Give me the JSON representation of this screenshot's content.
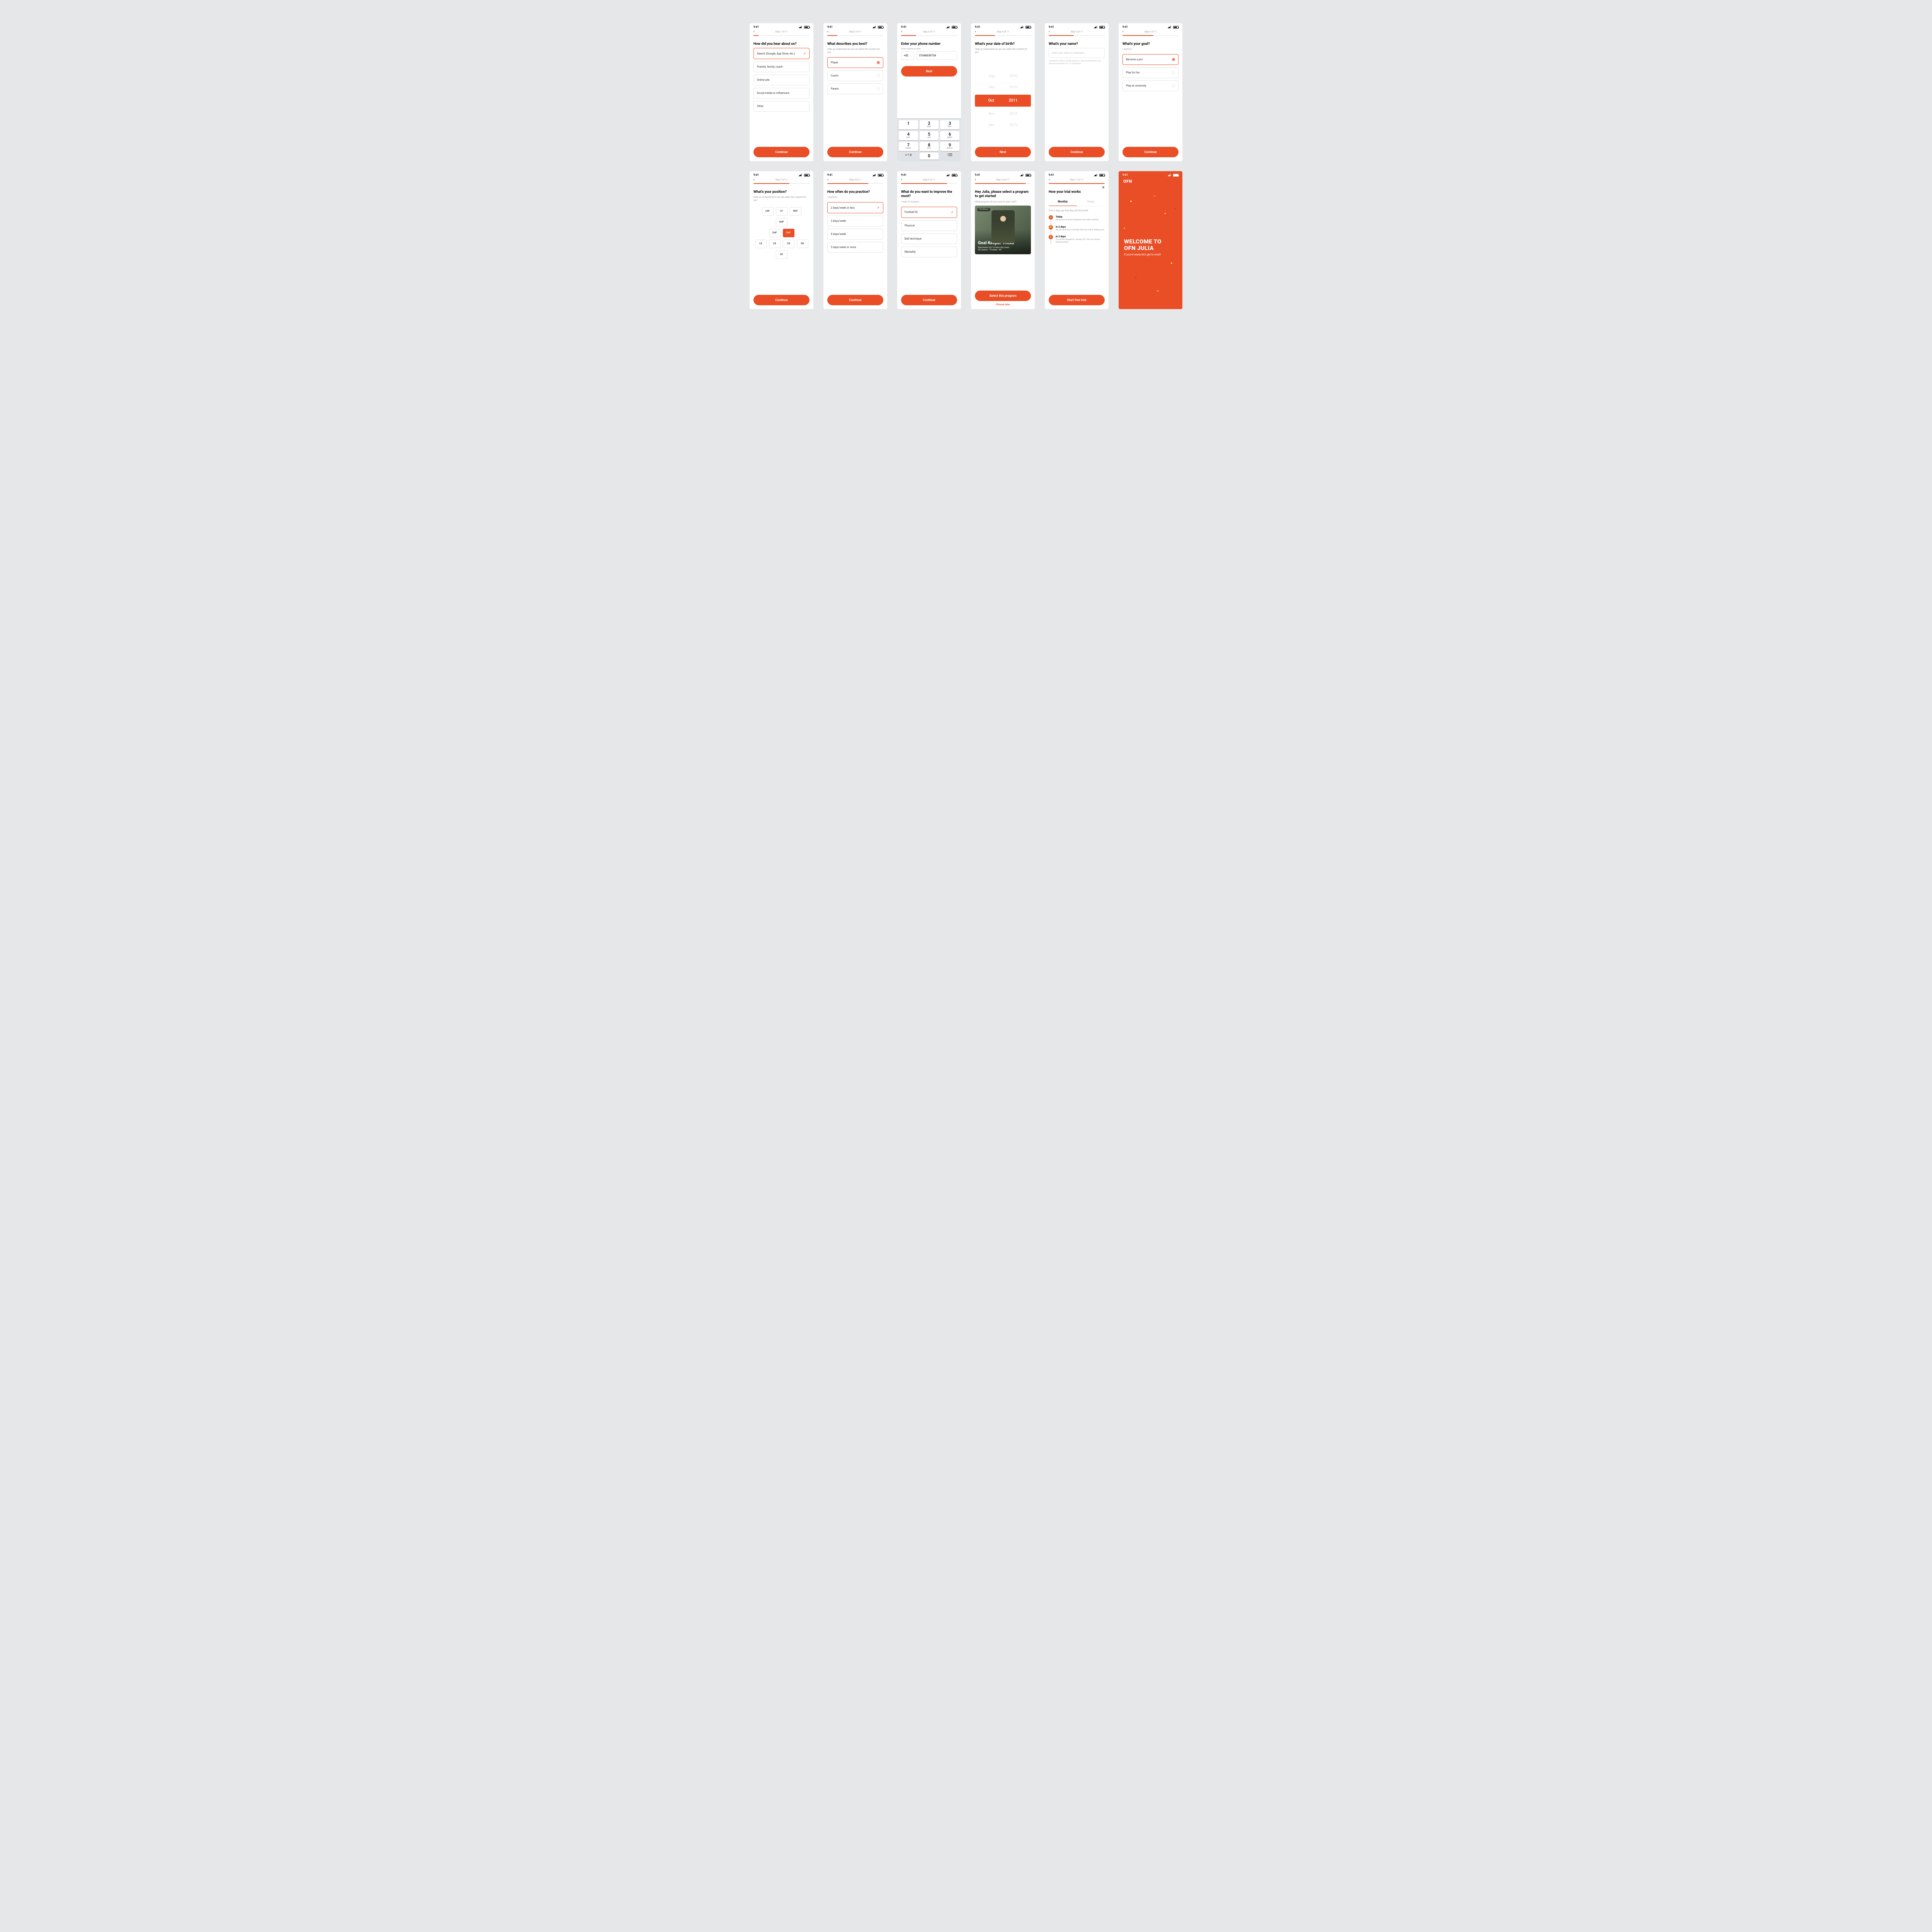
{
  "status": {
    "time": "9:41"
  },
  "colors": {
    "accent": "#E94E26"
  },
  "screens": [
    {
      "step": "Step 1 of 11",
      "progress": 0.09,
      "title": "How did you hear about us?",
      "options": [
        "Search  (Google, App Store, etc.)",
        "Friends, family, coach",
        "Online ads",
        "Social media or influencers",
        "Other"
      ],
      "selected_index": 0,
      "cta": "Continue"
    },
    {
      "step": "Step 2 of 11",
      "progress": 0.18,
      "title": "What describes you best?",
      "subtitle": "Help us understand so we can tailor the content for you",
      "options": [
        "Player",
        "Coach",
        "Parent"
      ],
      "selected_index": 0,
      "cta": "Continue"
    },
    {
      "step": "Step 3 of 11",
      "progress": 0.27,
      "title": "Enter your phone number",
      "field_label": "Enter mobile number",
      "country_code": "+82",
      "phone_value": "01046039734",
      "cta": "Next",
      "keypad": [
        {
          "n": "1",
          "l": ""
        },
        {
          "n": "2",
          "l": "ABC"
        },
        {
          "n": "3",
          "l": "DEF"
        },
        {
          "n": "4",
          "l": "GHI"
        },
        {
          "n": "5",
          "l": "JKL"
        },
        {
          "n": "6",
          "l": "MNO"
        },
        {
          "n": "7",
          "l": "PQRS"
        },
        {
          "n": "8",
          "l": "TUV"
        },
        {
          "n": "9",
          "l": "WXYZ"
        },
        {
          "n": "+ * #",
          "l": ""
        },
        {
          "n": "0",
          "l": ""
        },
        {
          "n": "⌫",
          "l": ""
        }
      ]
    },
    {
      "step": "Step 4 of 11",
      "progress": 0.36,
      "title": "What's your date of birth?",
      "subtitle": "Help us understand so we can tailor the content for you",
      "months": [
        "Aug",
        "Sep",
        "Oct",
        "Nov",
        "Dec"
      ],
      "years": [
        "2010",
        "2010",
        "2011",
        "2012",
        "2013"
      ],
      "selected_row": 2,
      "cta": "Next"
    },
    {
      "step": "Step 5 of 11",
      "progress": 0.45,
      "title": "What's your name?",
      "placeholder": "Enter your name or nickname",
      "helper": "Usernames cannot contain spaces or special characters, and should be between 6 to 15 characters.",
      "cta": "Continue"
    },
    {
      "step": "Step 6 of 11",
      "progress": 0.55,
      "title": "What's your goal?",
      "subtitle": "I want to…",
      "options": [
        "Become a pro",
        "Play for fun",
        "Play at university"
      ],
      "selected_index": 0,
      "cta": "Continue"
    },
    {
      "step": "Step 7 of 11",
      "progress": 0.64,
      "title": "What's your position?",
      "subtitle": "Help us understand so we can tailor the content for you",
      "positions": [
        [
          "LWF",
          "CF",
          "RWF"
        ],
        [
          "AMF"
        ],
        [
          "CMF",
          "DMF"
        ],
        [
          "LB",
          "CB",
          "CB",
          "RB"
        ],
        [
          "GK"
        ]
      ],
      "selected": "DMF",
      "cta": "Continue"
    },
    {
      "step": "Step 8 of 11",
      "progress": 0.73,
      "title": "How often do you practice?",
      "subtitle": "I practice…",
      "options": [
        "2 days/week or less",
        "3 days/week",
        "4 days/week",
        "5 days/week or more"
      ],
      "selected_index": 0,
      "cta": "Continue"
    },
    {
      "step": "Step 9 of 11",
      "progress": 0.82,
      "title": "What do you want to improve the most?",
      "subtitle": "I want to improve…",
      "options": [
        "Football IQ",
        "Physical",
        "Ball technique",
        "Mentality"
      ],
      "selected_index": 0,
      "cta": "Continue"
    },
    {
      "step": "Step 10 of 11",
      "progress": 0.91,
      "title": "Hey Julia, please select a program to get started",
      "subtitle": "What program do you want to start with?",
      "program": {
        "tag": "PHYSICAL",
        "name": "Goal Keeper Tricks",
        "meta1": "Manchester utd, 1st team s&c coach",
        "meta2": "25 Lessons · 10 weeks · WF"
      },
      "cta": "Select this program",
      "secondary": "Choose later"
    },
    {
      "step": "Step 11 of 11",
      "progress": 1.0,
      "title": "How your trial works",
      "tabs": [
        "Monthly",
        "Yearly"
      ],
      "active_tab": 0,
      "trial_note": "First 3 days are free then $9.99/month",
      "timeline": [
        {
          "icon": "lock",
          "heading": "Today",
          "body": "Get access to all our programs and video contents"
        },
        {
          "icon": "bell",
          "heading": "In 2 days",
          "body": "We will send you a reminder that your trial is ending soon"
        },
        {
          "icon": "star",
          "heading": "In 3 days",
          "body": "You will be charged on January 7th. You can cancel anytime before"
        }
      ],
      "cta": "Start free trial"
    },
    {
      "logo": "OFN",
      "welcome_title_1": "WELCOME TO",
      "welcome_title_2": "OFN JULIA",
      "welcome_sub": "If you're ready let's get to work!"
    }
  ]
}
